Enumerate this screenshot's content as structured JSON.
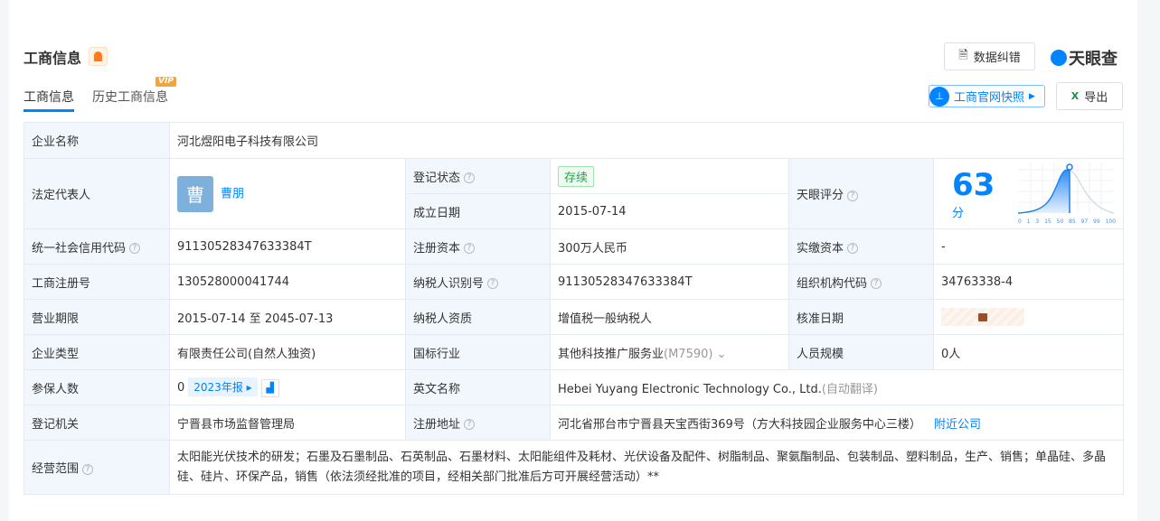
{
  "header": {
    "title": "工商信息",
    "tabs": [
      {
        "label": "工商信息"
      },
      {
        "label": "历史工商信息",
        "badge": "VIP"
      }
    ],
    "correct_label": "数据纠错",
    "logo": "天眼查",
    "snapshot_label": "工商官网快照",
    "export_label": "导出"
  },
  "company": {
    "name_label": "企业名称",
    "name": "河北煜阳电子科技有限公司",
    "legal_label": "法定代表人",
    "legal_avatar": "曹",
    "legal_name": "曹朋",
    "status_label": "登记状态",
    "status": "存续",
    "found_label": "成立日期",
    "found": "2015-07-14",
    "score_label": "天眼评分",
    "score": "63",
    "score_unit": "分",
    "score_ticks": [
      "0",
      "1",
      "3",
      "15",
      "50",
      "85",
      "97",
      "99",
      "100"
    ],
    "credit_label": "统一社会信用代码",
    "credit": "91130528347633384T",
    "capital_label": "注册资本",
    "capital": "300万人民币",
    "paid_label": "实缴资本",
    "paid": "-",
    "regno_label": "工商注册号",
    "regno": "130528000041744",
    "taxid_label": "纳税人识别号",
    "taxid": "91130528347633384T",
    "org_label": "组织机构代码",
    "org": "34763338-4",
    "term_label": "营业期限",
    "term": "2015-07-14 至 2045-07-13",
    "taxq_label": "纳税人资质",
    "taxq": "增值税一般纳税人",
    "approve_label": "核准日期",
    "type_label": "企业类型",
    "type": "有限责任公司(自然人独资)",
    "industry_label": "国标行业",
    "industry": "其他科技推广服务业",
    "industry_code": "(M7590)",
    "staff_label": "人员规模",
    "staff": "0人",
    "insured_label": "参保人数",
    "insured": "0",
    "report": "2023年报",
    "en_label": "英文名称",
    "en": "Hebei Yuyang Electronic Technology Co., Ltd.",
    "en_note": "(自动翻译)",
    "authority_label": "登记机关",
    "authority": "宁晋县市场监督管理局",
    "addr_label": "注册地址",
    "addr": "河北省邢台市宁晋县天宝西街369号（方大科技园企业服务中心三楼）",
    "nearby": "附近公司",
    "scope_label": "经营范围",
    "scope": "太阳能光伏技术的研发；石墨及石墨制品、石英制品、石墨材料、太阳能组件及耗材、光伏设备及配件、树脂制品、聚氨酯制品、包装制品、塑料制品，生产、销售；单晶硅、多晶硅、硅片、环保产品，销售（依法须经批准的项目，经相关部门批准后方可开展经营活动）**"
  }
}
